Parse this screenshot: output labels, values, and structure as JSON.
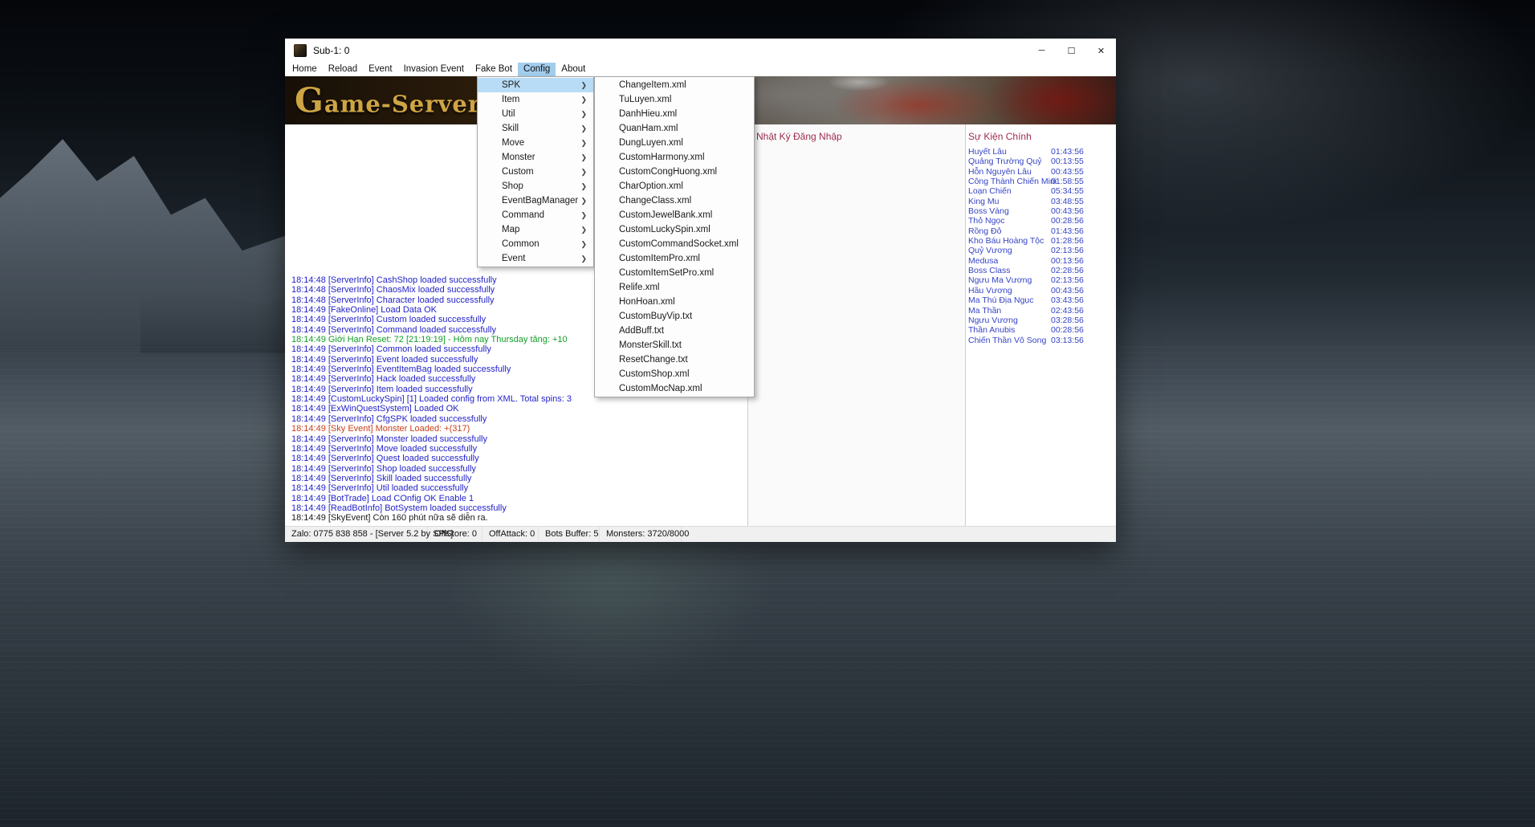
{
  "window": {
    "title": "Sub-1: 0",
    "controls": [
      {
        "name": "minimize",
        "glyph": "─"
      },
      {
        "name": "maximize",
        "glyph": "☐"
      },
      {
        "name": "close",
        "glyph": "✕"
      }
    ]
  },
  "menubar": {
    "items": [
      {
        "label": "Home",
        "active": false
      },
      {
        "label": "Reload",
        "active": false
      },
      {
        "label": "Event",
        "active": false
      },
      {
        "label": "Invasion Event",
        "active": false
      },
      {
        "label": "Fake Bot",
        "active": false
      },
      {
        "label": "Config",
        "active": true
      },
      {
        "label": "About",
        "active": false
      }
    ]
  },
  "banner": {
    "title": "Game-Server"
  },
  "icons": {
    "submenu_arrow": "❯"
  },
  "config_menu": {
    "items": [
      {
        "label": "SPK",
        "submenu": true,
        "highlighted": true
      },
      {
        "label": "Item",
        "submenu": true,
        "highlighted": false
      },
      {
        "label": "Util",
        "submenu": true,
        "highlighted": false
      },
      {
        "label": "Skill",
        "submenu": true,
        "highlighted": false
      },
      {
        "label": "Move",
        "submenu": true,
        "highlighted": false
      },
      {
        "label": "Monster",
        "submenu": true,
        "highlighted": false
      },
      {
        "label": "Custom",
        "submenu": true,
        "highlighted": false
      },
      {
        "label": "Shop",
        "submenu": true,
        "highlighted": false
      },
      {
        "label": "EventBagManager",
        "submenu": true,
        "highlighted": false
      },
      {
        "label": "Command",
        "submenu": true,
        "highlighted": false
      },
      {
        "label": "Map",
        "submenu": true,
        "highlighted": false
      },
      {
        "label": "Common",
        "submenu": true,
        "highlighted": false
      },
      {
        "label": "Event",
        "submenu": true,
        "highlighted": false
      }
    ]
  },
  "spk_submenu": {
    "items": [
      "ChangeItem.xml",
      "TuLuyen.xml",
      "DanhHieu.xml",
      "QuanHam.xml",
      "DungLuyen.xml",
      "CustomHarmony.xml",
      "CustomCongHuong.xml",
      "CharOption.xml",
      "ChangeClass.xml",
      "CustomJewelBank.xml",
      "CustomLuckySpin.xml",
      "CustomCommandSocket.xml",
      "CustomItemPro.xml",
      "CustomItemSetPro.xml",
      "Relife.xml",
      "HonHoan.xml",
      "CustomBuyVip.txt",
      "AddBuff.txt",
      "MonsterSkill.txt",
      "ResetChange.txt",
      "CustomShop.xml",
      "CustomMocNap.xml"
    ]
  },
  "log": {
    "lines": [
      {
        "text": "18:14:48 [ServerInfo] CashShop loaded successfully",
        "color": "blue"
      },
      {
        "text": "18:14:48 [ServerInfo] ChaosMix loaded successfully",
        "color": "blue"
      },
      {
        "text": "18:14:48 [ServerInfo] Character loaded successfully",
        "color": "blue"
      },
      {
        "text": "18:14:49 [FakeOnline] Load Data OK",
        "color": "blue"
      },
      {
        "text": "18:14:49 [ServerInfo] Custom loaded successfully",
        "color": "blue"
      },
      {
        "text": "18:14:49 [ServerInfo] Command loaded successfully",
        "color": "blue"
      },
      {
        "text": "18:14:49 Giới Hạn Reset: 72 [21:19:19] - Hôm nay Thursday tăng: +10",
        "color": "green"
      },
      {
        "text": "18:14:49 [ServerInfo] Common loaded successfully",
        "color": "blue"
      },
      {
        "text": "18:14:49 [ServerInfo] Event loaded successfully",
        "color": "blue"
      },
      {
        "text": "18:14:49 [ServerInfo] EventItemBag loaded successfully",
        "color": "blue"
      },
      {
        "text": "18:14:49 [ServerInfo] Hack loaded successfully",
        "color": "blue"
      },
      {
        "text": "18:14:49 [ServerInfo] Item loaded successfully",
        "color": "blue"
      },
      {
        "text": "18:14:49 [CustomLuckySpin] [1] Loaded config from XML. Total spins: 3",
        "color": "blue"
      },
      {
        "text": "18:14:49 [ExWinQuestSystem] Loaded OK",
        "color": "blue"
      },
      {
        "text": "18:14:49 [ServerInfo] CfgSPK loaded successfully",
        "color": "blue"
      },
      {
        "text": "18:14:49 [Sky Event] Monster Loaded: +(317)",
        "color": "red"
      },
      {
        "text": "18:14:49 [ServerInfo] Monster loaded successfully",
        "color": "blue"
      },
      {
        "text": "18:14:49 [ServerInfo] Move loaded successfully",
        "color": "blue"
      },
      {
        "text": "18:14:49 [ServerInfo] Quest loaded successfully",
        "color": "blue"
      },
      {
        "text": "18:14:49 [ServerInfo] Shop loaded successfully",
        "color": "blue"
      },
      {
        "text": "18:14:49 [ServerInfo] Skill loaded successfully",
        "color": "blue"
      },
      {
        "text": "18:14:49 [ServerInfo] Util loaded successfully",
        "color": "blue"
      },
      {
        "text": "18:14:49 [BotTrade] Load COnfig OK Enable 1",
        "color": "blue"
      },
      {
        "text": "18:14:49 [ReadBotInfo] BotSystem loaded successfully",
        "color": "blue"
      },
      {
        "text": "18:14:49 [SkyEvent] Còn 160 phút nữa sẽ diễn ra.",
        "color": "black"
      }
    ]
  },
  "login_log_panel": {
    "title": "Nhật Ký Đăng Nhập"
  },
  "events_panel": {
    "title": "Sự Kiện Chính",
    "rows": [
      {
        "name": "Huyết Lâu",
        "time": "01:43:56"
      },
      {
        "name": "Quảng Trường Quỷ",
        "time": "00:13:55"
      },
      {
        "name": "Hỗn Nguyên Lâu",
        "time": "00:43:55"
      },
      {
        "name": "Công Thành Chiến Mini",
        "time": "01:58:55"
      },
      {
        "name": "Loạn Chiến",
        "time": "05:34:55"
      },
      {
        "name": "King Mu",
        "time": "03:48:55"
      },
      {
        "name": "Boss Vàng",
        "time": "00:43:56"
      },
      {
        "name": "Thỏ Ngọc",
        "time": "00:28:56"
      },
      {
        "name": "Rồng Đỏ",
        "time": "01:43:56"
      },
      {
        "name": "Kho Báu Hoàng Tộc",
        "time": "01:28:56"
      },
      {
        "name": "Quỷ Vương",
        "time": "02:13:56"
      },
      {
        "name": "Medusa",
        "time": "00:13:56"
      },
      {
        "name": "Boss Class",
        "time": "02:28:56"
      },
      {
        "name": "Ngưu Ma Vương",
        "time": "02:13:56"
      },
      {
        "name": "Hầu Vương",
        "time": "00:43:56"
      },
      {
        "name": "Ma Thú Địa Ngục",
        "time": "03:43:56"
      },
      {
        "name": "Ma Thần",
        "time": "02:43:56"
      },
      {
        "name": "Ngưu Vương",
        "time": "03:28:56"
      },
      {
        "name": "Thần Anubis",
        "time": "00:28:56"
      },
      {
        "name": "Chiến Thần Vô Song",
        "time": "03:13:56"
      }
    ]
  },
  "status_bar": {
    "items": [
      "Zalo: 0775 838 858 - [Server 5.2 by SPK]",
      "OffStore: 0",
      "OffAttack: 0",
      "Bots Buffer: 5",
      "Monsters: 3720/8000"
    ]
  },
  "colors": {
    "log_blue": "#2323c9",
    "log_green": "#129e27",
    "log_red": "#c8401a",
    "header_maroon": "#9c2d4c",
    "event_blue": "#3644c4",
    "menu_highlight": "#b8dcf5",
    "banner_gold": "#cfa544"
  }
}
